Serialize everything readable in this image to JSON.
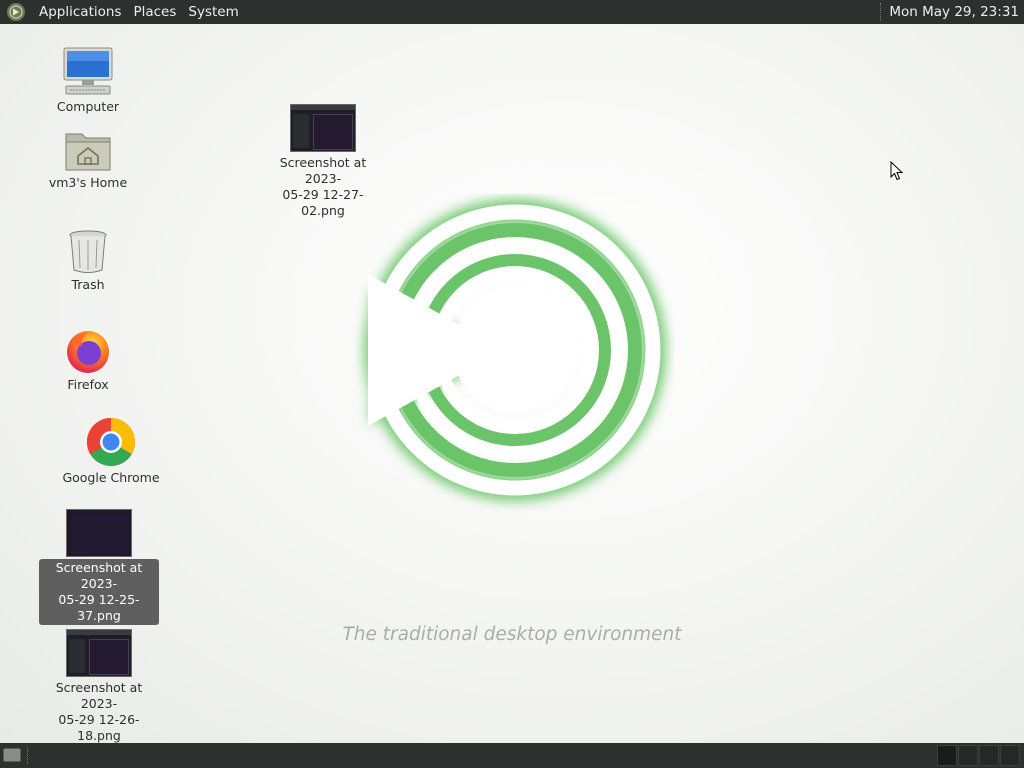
{
  "top_panel": {
    "menus": [
      "Applications",
      "Places",
      "System"
    ],
    "clock": "Mon May 29, 23:31"
  },
  "desktop": {
    "tagline": "The traditional desktop environment",
    "icons": [
      {
        "label": "Computer",
        "icon": "computer-icon"
      },
      {
        "label": "vm3's Home",
        "icon": "home-folder-icon"
      },
      {
        "label": "Trash",
        "icon": "trash-icon"
      },
      {
        "label": "Firefox",
        "icon": "firefox-icon"
      },
      {
        "label": "Google Chrome",
        "icon": "chrome-icon"
      },
      {
        "label": "Screenshot at 2023-05-29 12-25-37.png",
        "label_line1": "Screenshot at 2023-",
        "label_line2": "05-29 12-25-37.png",
        "icon": "image-thumbnail-icon",
        "selected": true
      },
      {
        "label": "Screenshot at 2023-05-29 12-26-18.png",
        "label_line1": "Screenshot at 2023-",
        "label_line2": "05-29 12-26-18.png",
        "icon": "image-thumbnail-icon"
      },
      {
        "label": "Screenshot at 2023-05-29 12-27-02.png",
        "label_line1": "Screenshot at 2023-",
        "label_line2": "05-29 12-27-02.png",
        "icon": "image-thumbnail-icon"
      }
    ]
  },
  "bottom_panel": {
    "workspaces": 4,
    "active_workspace": 1
  },
  "colors": {
    "panel": "#2e3030",
    "accent_green": "#6cc46a",
    "selection": "#5f5f5f"
  }
}
